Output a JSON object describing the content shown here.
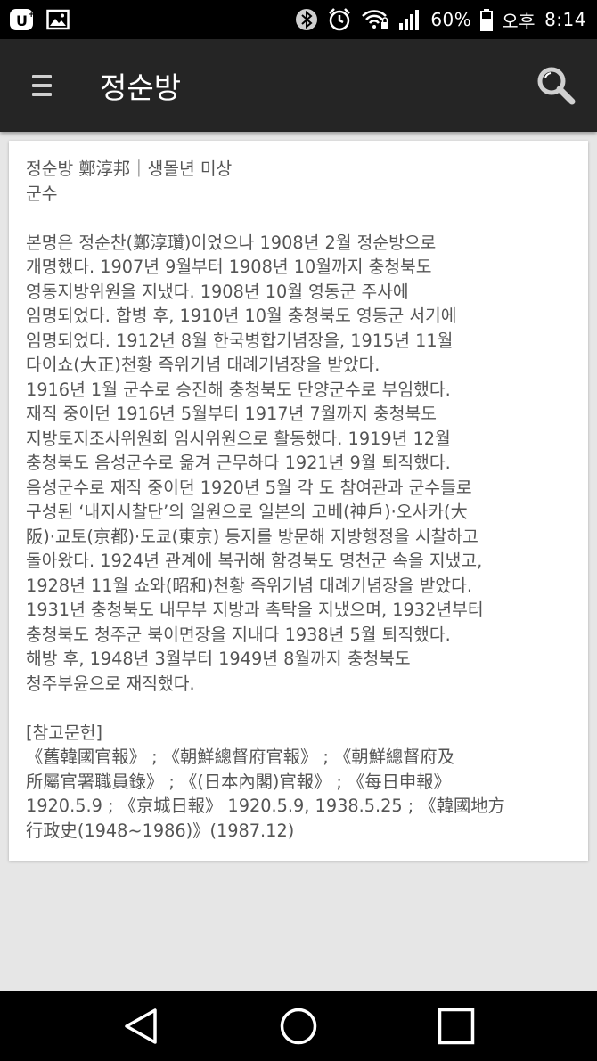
{
  "status_bar": {
    "battery_percent": "60%",
    "ampm": "오후",
    "time": "8:14",
    "icons": [
      "u-plus-icon",
      "gallery-icon",
      "bluetooth-icon",
      "alarm-icon",
      "wifi-lock-icon",
      "signal-icon",
      "battery-icon"
    ]
  },
  "app_bar": {
    "title": "정순방",
    "icons": [
      "menu-icon",
      "search-icon"
    ]
  },
  "article": {
    "header_lines": [
      "정순방 鄭淳邦｜생몰년 미상",
      "군수"
    ],
    "body_lines": [
      "본명은 정순찬(鄭淳瓚)이었으나 1908년 2월 정순방으로",
      "개명했다. 1907년 9월부터 1908년 10월까지 충청북도",
      "영동지방위원을 지냈다. 1908년 10월 영동군 주사에",
      "임명되었다. 합병 후, 1910년 10월 충청북도 영동군 서기에",
      "임명되었다. 1912년 8월 한국병합기념장을, 1915년 11월",
      "다이쇼(大正)천황 즉위기념 대례기념장을 받았다.",
      "1916년 1월 군수로 승진해 충청북도 단양군수로 부임했다.",
      "재직 중이던 1916년 5월부터 1917년 7월까지 충청북도",
      "지방토지조사위원회 임시위원으로 활동했다. 1919년 12월",
      "충청북도 음성군수로 옮겨 근무하다 1921년 9월 퇴직했다.",
      "음성군수로 재직 중이던 1920년 5월 각 도 참여관과 군수들로",
      "구성된 ‘내지시찰단’의 일원으로 일본의 고베(神戶)·오사카(大",
      "阪)·교토(京都)·도쿄(東京) 등지를 방문해 지방행정을 시찰하고",
      "돌아왔다. 1924년 관계에 복귀해 함경북도 명천군 속을 지냈고,",
      "1928년 11월 쇼와(昭和)천황 즉위기념 대례기념장을 받았다.",
      "1931년 충청북도 내무부 지방과 촉탁을 지냈으며, 1932년부터",
      "충청북도 청주군 북이면장을 지내다 1938년 5월 퇴직했다.",
      "해방 후, 1948년 3월부터 1949년 8월까지 충청북도",
      "청주부윤으로 재직했다."
    ],
    "references_title": "[참고문헌]",
    "references_lines": [
      "《舊韓國官報》 ; 《朝鮮總督府官報》 ; 《朝鮮總督府及",
      "所屬官署職員錄》 ; 《(日本內閣)官報》 ; 《每日申報》",
      "1920.5.9 ; 《京城日報》 1920.5.9, 1938.5.25 ; 《韓國地方",
      "行政史(1948~1986)》(1987.12)"
    ]
  },
  "nav_bar": {
    "icons": [
      "back-icon",
      "home-icon",
      "recents-icon"
    ]
  }
}
